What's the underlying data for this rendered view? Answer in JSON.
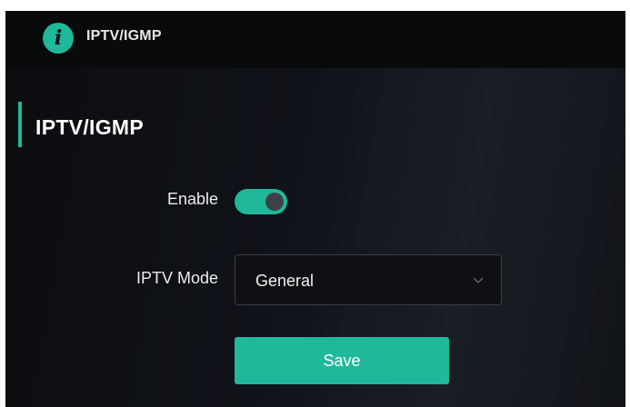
{
  "header": {
    "icon": "info-icon",
    "icon_glyph": "i",
    "title": "IPTV/IGMP"
  },
  "main": {
    "title": "IPTV/IGMP",
    "enable": {
      "label": "Enable",
      "value": true
    },
    "iptv_mode": {
      "label": "IPTV Mode",
      "value": "General"
    },
    "save_label": "Save"
  },
  "colors": {
    "accent": "#1fb99a",
    "background": "#0b0c0e",
    "text": "#ffffff"
  }
}
